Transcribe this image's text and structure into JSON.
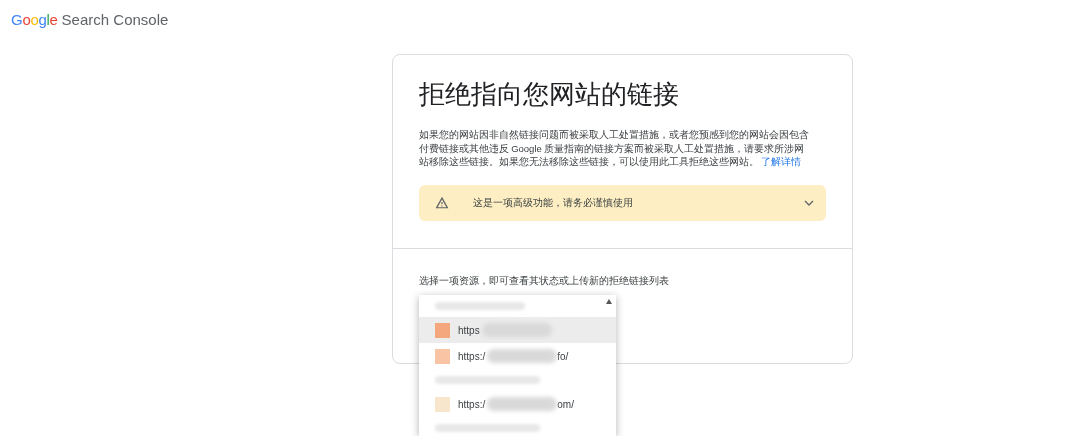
{
  "header": {
    "logo_word": "Google",
    "product": "Search Console"
  },
  "card": {
    "title": "拒绝指向您网站的链接",
    "description": "如果您的网站因非自然链接问题而被采取人工处置措施，或者您预感到您的网站会因包含付费链接或其他违反 Google 质量指南的链接方案而被采取人工处置措施，请要求所涉网站移除这些链接。如果您无法移除这些链接，可以使用此工具拒绝这些网站。",
    "learn_more": "了解详情",
    "warning": {
      "text": "这是一项高级功能，请务必谨慎使用",
      "expanded": false
    },
    "property_prompt": "选择一项资源，即可查看其状态或上传新的拒绝链接列表"
  },
  "dropdown": {
    "items": [
      {
        "kind": "group"
      },
      {
        "kind": "property",
        "prefix": "https",
        "color": "#f4a67c",
        "selected": true
      },
      {
        "kind": "property",
        "prefix": "https:/",
        "suffix": "fo/",
        "color": "#f9c4a4",
        "selected": false
      },
      {
        "kind": "group"
      },
      {
        "kind": "property",
        "prefix": "https:/",
        "suffix": "om/",
        "color": "#f7e6cc",
        "selected": false
      },
      {
        "kind": "group"
      }
    ]
  }
}
